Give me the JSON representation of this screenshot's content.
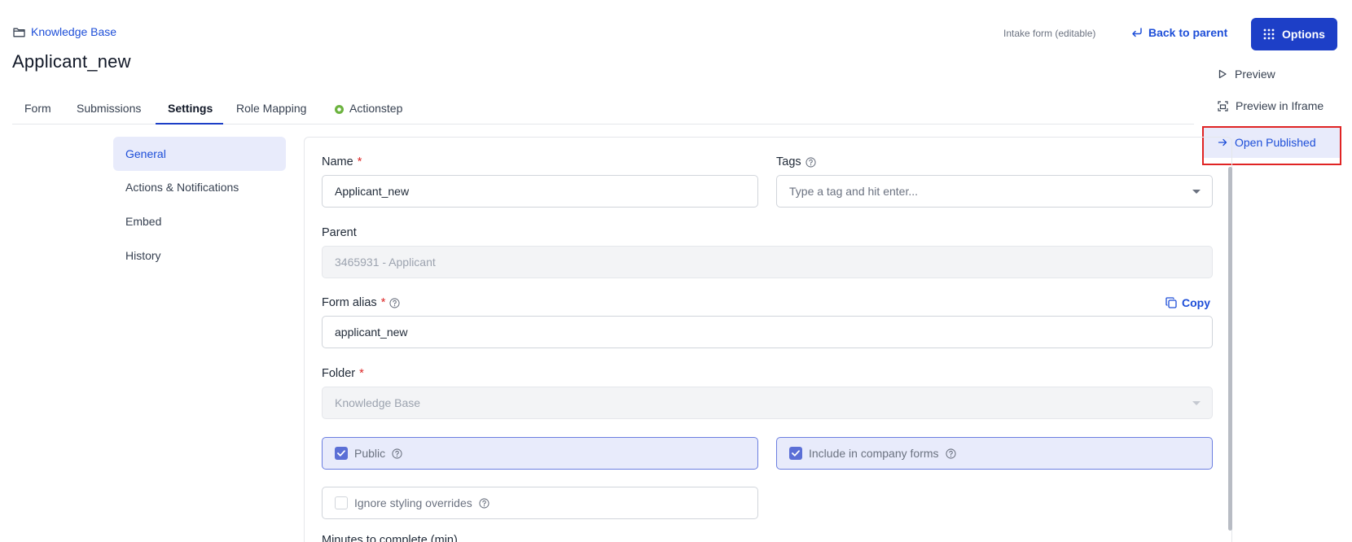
{
  "header": {
    "breadcrumb": "Knowledge Base",
    "title": "Applicant_new",
    "mode_label": "Intake form (editable)",
    "back_label": "Back to parent",
    "options_label": "Options"
  },
  "options_menu": {
    "items": [
      {
        "label": "Preview",
        "icon": "play-icon"
      },
      {
        "label": "Preview in Iframe",
        "icon": "iframe-icon"
      },
      {
        "label": "Open Published",
        "icon": "arrow-right-icon",
        "highlighted": true
      }
    ]
  },
  "tabs": [
    {
      "label": "Form"
    },
    {
      "label": "Submissions"
    },
    {
      "label": "Settings",
      "active": true
    },
    {
      "label": "Role Mapping"
    },
    {
      "label": "Actionstep",
      "icon": "actionstep-icon"
    }
  ],
  "side_nav": [
    {
      "label": "General",
      "active": true
    },
    {
      "label": "Actions & Notifications"
    },
    {
      "label": "Embed"
    },
    {
      "label": "History"
    }
  ],
  "form": {
    "name": {
      "label": "Name",
      "required": "*",
      "value": "Applicant_new"
    },
    "tags": {
      "label": "Tags",
      "placeholder": "Type a tag and hit enter..."
    },
    "parent": {
      "label": "Parent",
      "value": "3465931 - Applicant"
    },
    "alias": {
      "label": "Form alias",
      "required": "*",
      "value": "applicant_new",
      "copy_label": "Copy"
    },
    "folder": {
      "label": "Folder",
      "required": "*",
      "value": "Knowledge Base"
    },
    "public": {
      "label": "Public",
      "checked": true
    },
    "company_forms": {
      "label": "Include in company forms",
      "checked": true
    },
    "ignore_styling": {
      "label": "Ignore styling overrides",
      "checked": false
    },
    "next_label": "Minutes to complete (min)"
  },
  "colors": {
    "primary": "#1d3fc7",
    "link": "#1d4ed8",
    "highlight_border": "#e02424",
    "selected_bg": "#e8ebfb",
    "actionstep_green": "#6cb33f"
  }
}
